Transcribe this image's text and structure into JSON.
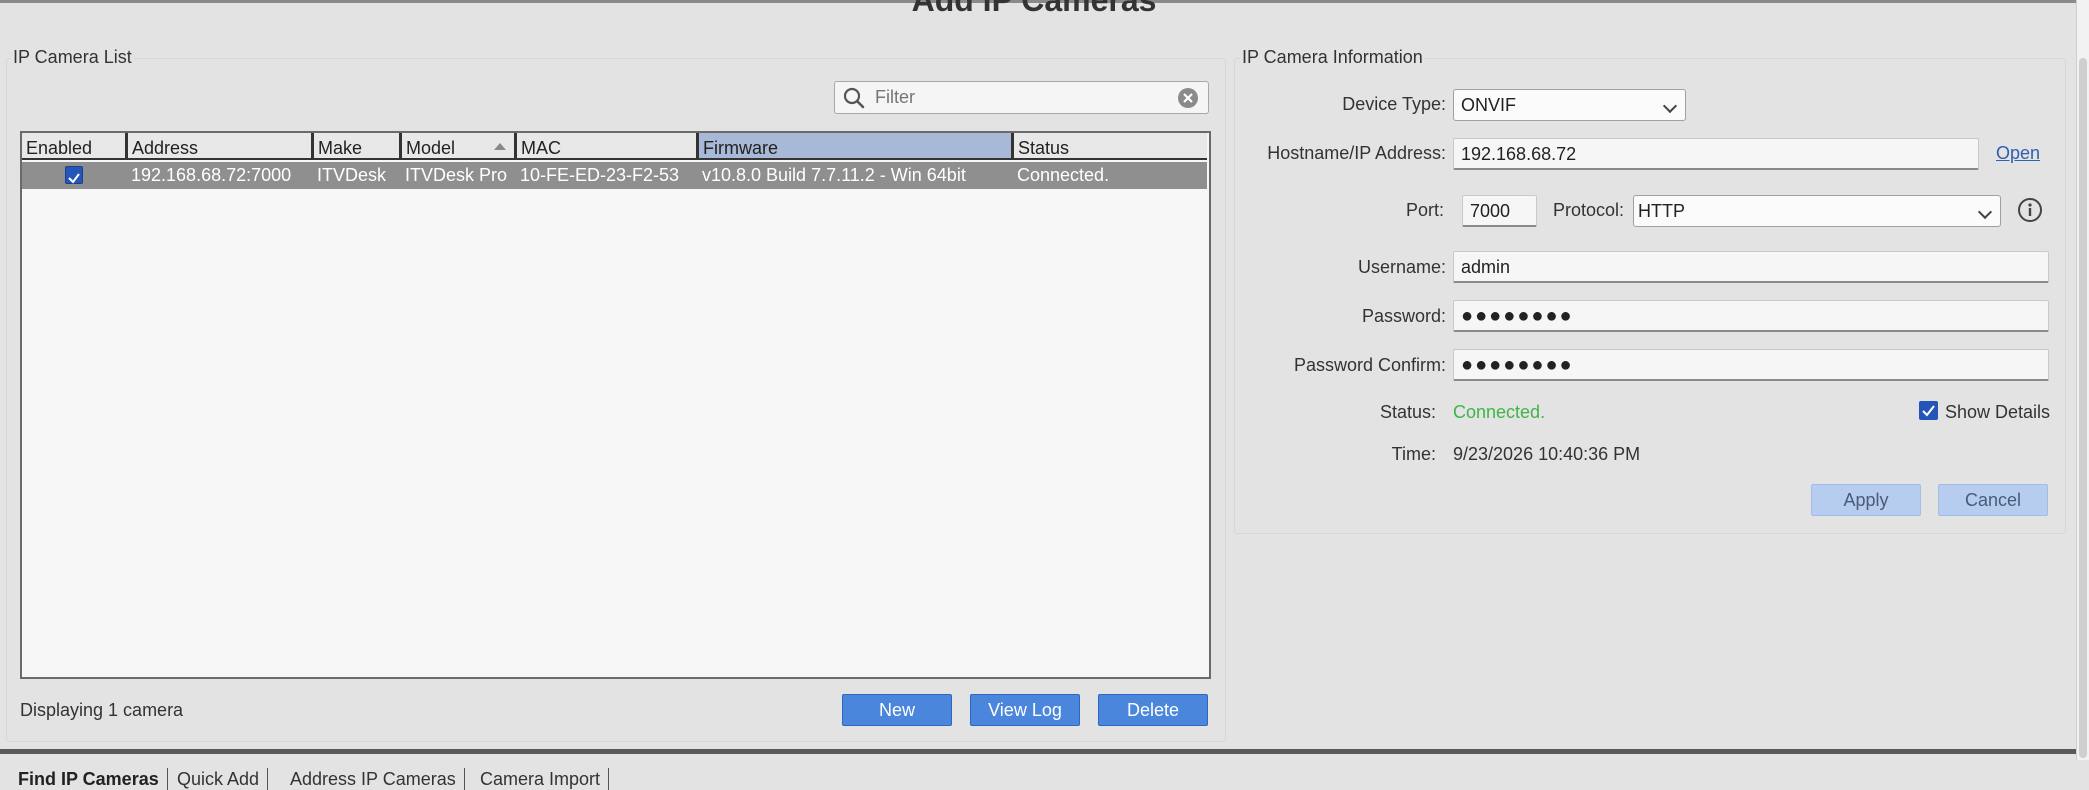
{
  "page": {
    "title": "Add IP Cameras"
  },
  "camera_list": {
    "group_title": "IP Camera List",
    "filter_placeholder": "Filter",
    "columns": [
      "Enabled",
      "Address",
      "Make",
      "Model",
      "MAC",
      "Firmware",
      "Status"
    ],
    "rows": [
      {
        "enabled": true,
        "address": "192.168.68.72:7000",
        "make": "ITVDesk",
        "model": "ITVDesk Pro",
        "mac": "10-FE-ED-23-F2-53",
        "firmware": "v10.8.0 Build 7.7.11.2 - Win 64bit",
        "status": "Connected."
      }
    ],
    "footer_text": "Displaying 1 camera",
    "buttons": {
      "new": "New",
      "view_log": "View Log",
      "delete": "Delete"
    }
  },
  "camera_info": {
    "group_title": "IP Camera Information",
    "device_type_label": "Device Type:",
    "device_type": "ONVIF",
    "hostname_label": "Hostname/IP Address:",
    "hostname": "192.168.68.72",
    "open_link": "Open",
    "port_label": "Port:",
    "port": "7000",
    "protocol_label": "Protocol:",
    "protocol": "HTTP",
    "username_label": "Username:",
    "username": "admin",
    "password_label": "Password:",
    "password": "●●●●●●●●",
    "password_confirm_label": "Password Confirm:",
    "password_confirm": "●●●●●●●●",
    "status_label": "Status:",
    "status": "Connected.",
    "show_details_label": "Show Details",
    "show_details_checked": true,
    "time_label": "Time:",
    "time": "9/23/2026 10:40:36 PM",
    "buttons": {
      "apply": "Apply",
      "cancel": "Cancel"
    }
  },
  "tabs": [
    {
      "label": "Find IP Cameras",
      "active": true
    },
    {
      "label": "Quick Add",
      "active": false
    },
    {
      "label": "Address IP Cameras",
      "active": false
    },
    {
      "label": "Camera Import",
      "active": false
    }
  ],
  "colors": {
    "accent": "#4a86db",
    "status_connected": "#3fb548",
    "selected_row": "#8f8f8f",
    "selected_header": "#a7b9d6"
  }
}
